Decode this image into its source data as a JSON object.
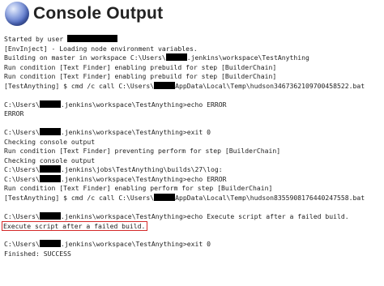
{
  "page": {
    "title": "Console Output",
    "title_icon": "globe-icon"
  },
  "console": {
    "l01": "Started by user ",
    "l02": "[EnvInject] - Loading node environment variables.",
    "l03a": "Building on master in workspace C:\\Users\\",
    "l03b": ".jenkins\\workspace\\TestAnything",
    "l04": "Run condition [Text Finder] enabling prebuild for step [BuilderChain]",
    "l05": "Run condition [Text Finder] enabling prebuild for step [BuilderChain]",
    "l06a": "[TestAnything] $ cmd /c call C:\\Users\\",
    "l06b": "AppData\\Local\\Temp\\hudson3467362109700458522.bat",
    "l07a": "C:\\Users\\",
    "l07b": ".jenkins\\workspace\\TestAnything>echo ERROR",
    "l08": "ERROR",
    "l09a": "C:\\Users\\",
    "l09b": ".jenkins\\workspace\\TestAnything>exit 0",
    "l10": "Checking console output",
    "l11": "Run condition [Text Finder] preventing perform for step [BuilderChain]",
    "l12": "Checking console output",
    "l13a": "C:\\Users\\",
    "l13b": ".jenkins\\jobs\\TestAnything\\builds\\27\\log:",
    "l14a": "C:\\Users\\",
    "l14b": ".jenkins\\workspace\\TestAnything>echo ERROR",
    "l15": "Run condition [Text Finder] enabling perform for step [BuilderChain]",
    "l16a": "[TestAnything] $ cmd /c call C:\\Users\\",
    "l16b": "AppData\\Local\\Temp\\hudson8355908176440247558.bat",
    "l17a": "C:\\Users\\",
    "l17b": ".jenkins\\workspace\\TestAnything>echo Execute script after a failed build.",
    "l18": "Execute script after a failed build.",
    "l19a": "C:\\Users\\",
    "l19b": ".jenkins\\workspace\\TestAnything>exit 0",
    "l20": "Finished: SUCCESS"
  },
  "colors": {
    "highlight_border": "#d42a2a",
    "redaction": "#000000"
  }
}
